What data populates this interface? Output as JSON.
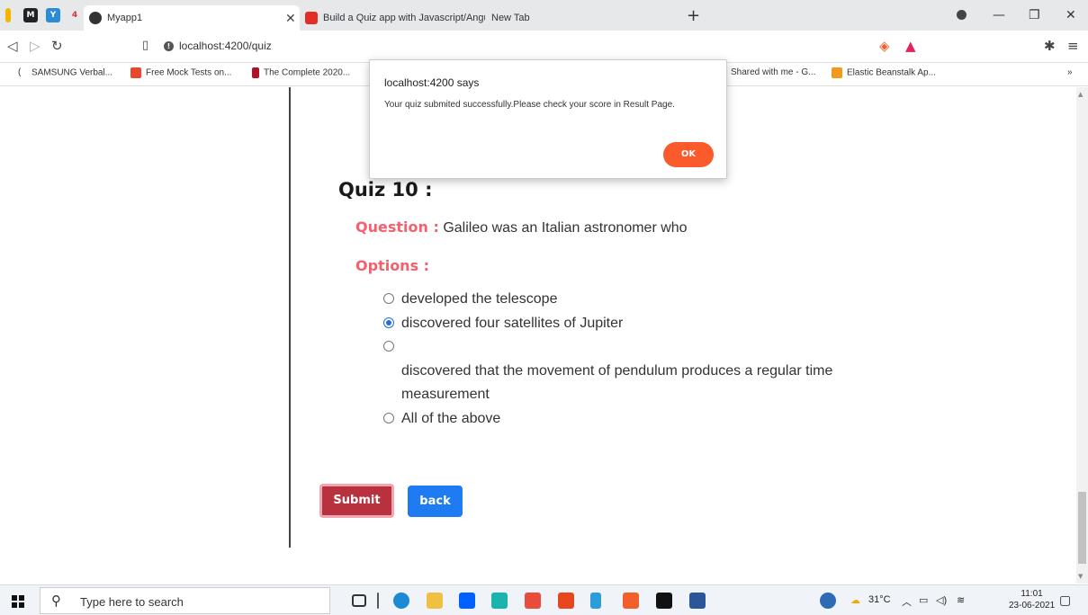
{
  "browser": {
    "tabs": [
      {
        "label": "Myapp1",
        "active": true
      },
      {
        "label": "Build a Quiz app with Javascript/Angu",
        "active": false
      },
      {
        "label": "New Tab",
        "active": false
      }
    ],
    "url": "localhost:4200/quiz"
  },
  "bookmarks": [
    "SAMSUNG Verbal...",
    "Free Mock Tests on...",
    "The Complete 2020...",
    "Shared with me - G...",
    "Elastic Beanstalk Ap..."
  ],
  "bookmarks_overflow": "»",
  "dialog": {
    "title": "localhost:4200 says",
    "message": "Your quiz submited successfully.Please check your score in Result Page.",
    "ok_label": "OK"
  },
  "quiz": {
    "title": "Quiz 10 :",
    "question_label": "Question :",
    "question_text": "Galileo was an Italian astronomer who",
    "options_label": "Options :",
    "options": [
      {
        "text": "developed the telescope",
        "selected": false
      },
      {
        "text": "discovered four satellites of Jupiter",
        "selected": true
      },
      {
        "text": "discovered that the movement of pendulum produces a regular time measurement",
        "selected": false
      },
      {
        "text": "All of the above",
        "selected": false
      }
    ],
    "submit_label": "Submit",
    "back_label": "back"
  },
  "taskbar": {
    "search_placeholder": "Type here to search",
    "weather": "31°C",
    "time": "11:01",
    "date": "23-06-2021"
  },
  "colors": {
    "accent_red": "#f4606d",
    "submit_bg": "#b8313e",
    "back_bg": "#1f7bf2",
    "ok_bg": "#fa5a2c"
  }
}
